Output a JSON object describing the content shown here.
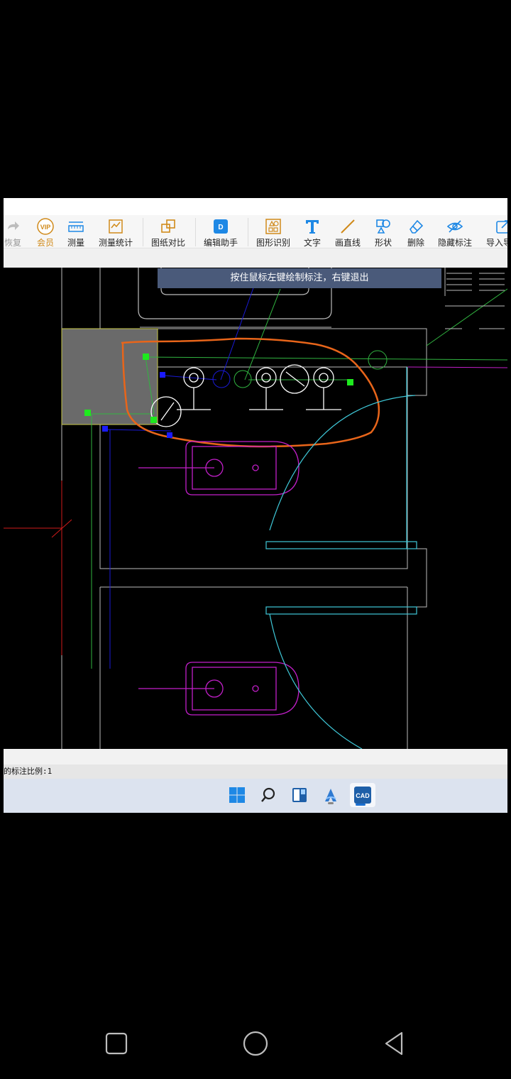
{
  "toolbar": {
    "items": [
      {
        "label": "恢复",
        "icon": "redo-icon"
      },
      {
        "label": "会员",
        "icon": "vip-icon"
      },
      {
        "label": "测量",
        "icon": "ruler-icon"
      },
      {
        "label": "测量统计",
        "icon": "measure-stats-icon"
      },
      {
        "label": "图纸对比",
        "icon": "compare-icon"
      },
      {
        "label": "编辑助手",
        "icon": "edit-assistant-icon"
      },
      {
        "label": "图形识别",
        "icon": "shape-recognition-icon"
      },
      {
        "label": "文字",
        "icon": "text-icon"
      },
      {
        "label": "画直线",
        "icon": "line-icon"
      },
      {
        "label": "形状",
        "icon": "shapes-icon"
      },
      {
        "label": "删除",
        "icon": "eraser-icon"
      },
      {
        "label": "隐藏标注",
        "icon": "hide-eye-icon"
      },
      {
        "label": "导入导",
        "icon": "import-icon"
      }
    ]
  },
  "hint": {
    "text": "按住鼠标左键绘制标注，右键退出"
  },
  "status": {
    "text": "的标注比例:1"
  },
  "taskbar": {
    "icons": [
      "windows-start-icon",
      "search-icon",
      "widgets-icon",
      "app-a-icon",
      "cad-app-icon"
    ]
  },
  "colors": {
    "accent_orange": "#e8651a",
    "cad_cyan": "#3fc8d8",
    "cad_magenta": "#c21fc9",
    "cad_green": "#31b541",
    "cad_blue": "#1a1ad6",
    "cad_red": "#d11a1a"
  }
}
